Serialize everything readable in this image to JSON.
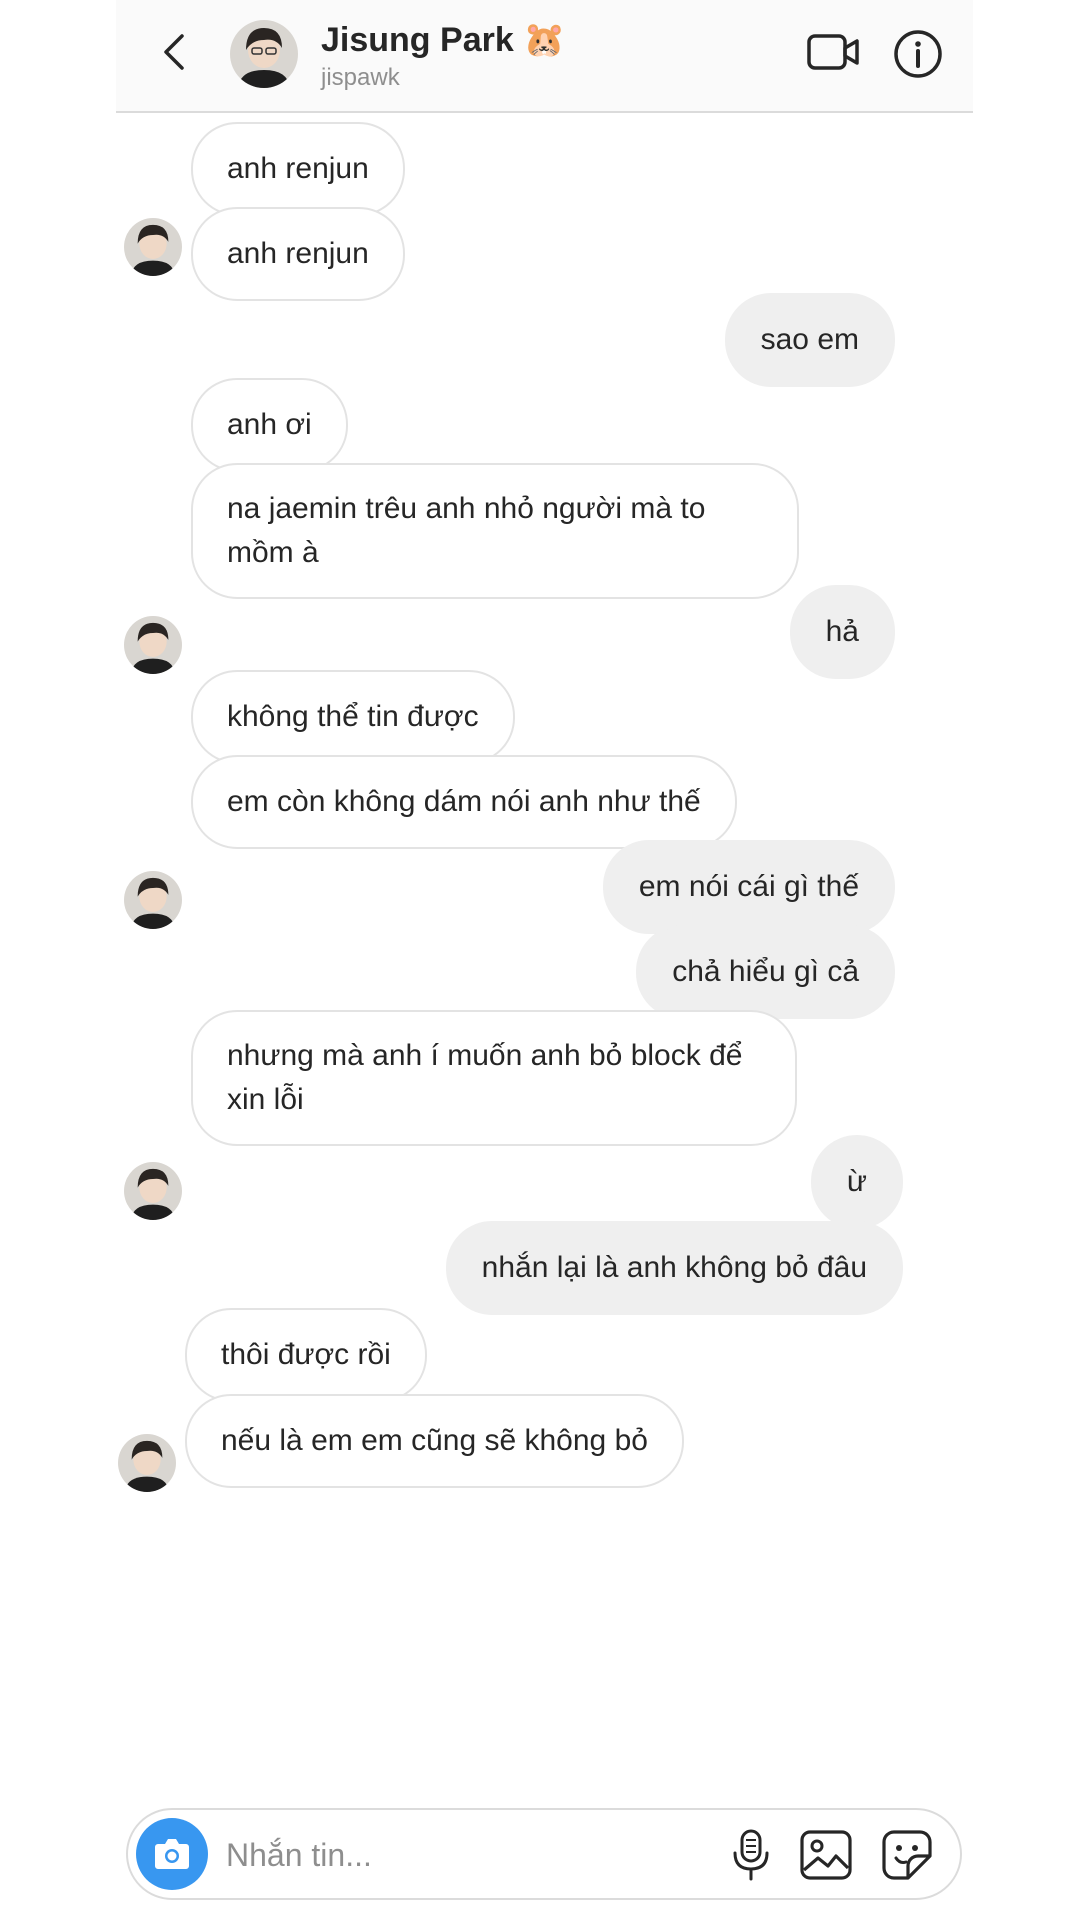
{
  "header": {
    "name": "Jisung Park 🐹",
    "username": "jispawk",
    "back_icon": "chevron-left-icon",
    "video_icon": "video-camera-icon",
    "info_icon": "info-icon"
  },
  "messages": [
    {
      "sender": "them",
      "text": "anh renjun"
    },
    {
      "sender": "them",
      "text": "anh renjun"
    },
    {
      "sender": "me",
      "text": "sao em"
    },
    {
      "sender": "them",
      "text": "anh ơi"
    },
    {
      "sender": "them",
      "text": "na jaemin trêu anh nhỏ người mà to mồm à"
    },
    {
      "sender": "me",
      "text": "hả"
    },
    {
      "sender": "them",
      "text": "không thể tin được"
    },
    {
      "sender": "them",
      "text": "em còn không dám nói anh như thế"
    },
    {
      "sender": "me",
      "text": "em nói cái gì thế"
    },
    {
      "sender": "me",
      "text": "chả hiểu gì cả"
    },
    {
      "sender": "them",
      "text": "nhưng mà anh í muốn anh bỏ block để xin lỗi"
    },
    {
      "sender": "me",
      "text": "ừ"
    },
    {
      "sender": "me",
      "text": "nhắn lại là anh không bỏ đâu"
    },
    {
      "sender": "them",
      "text": "thôi được rồi"
    },
    {
      "sender": "them",
      "text": "nếu là em em cũng sẽ không bỏ"
    }
  ],
  "composer": {
    "placeholder": "Nhắn tin...",
    "value": "",
    "camera_icon": "camera-icon",
    "mic_icon": "microphone-icon",
    "gallery_icon": "image-icon",
    "sticker_icon": "sticker-icon"
  },
  "colors": {
    "accent": "#3897f0",
    "outgoing_bubble": "#efefef",
    "incoming_border": "#e3e3e3",
    "secondary_text": "#8e8e8e"
  }
}
